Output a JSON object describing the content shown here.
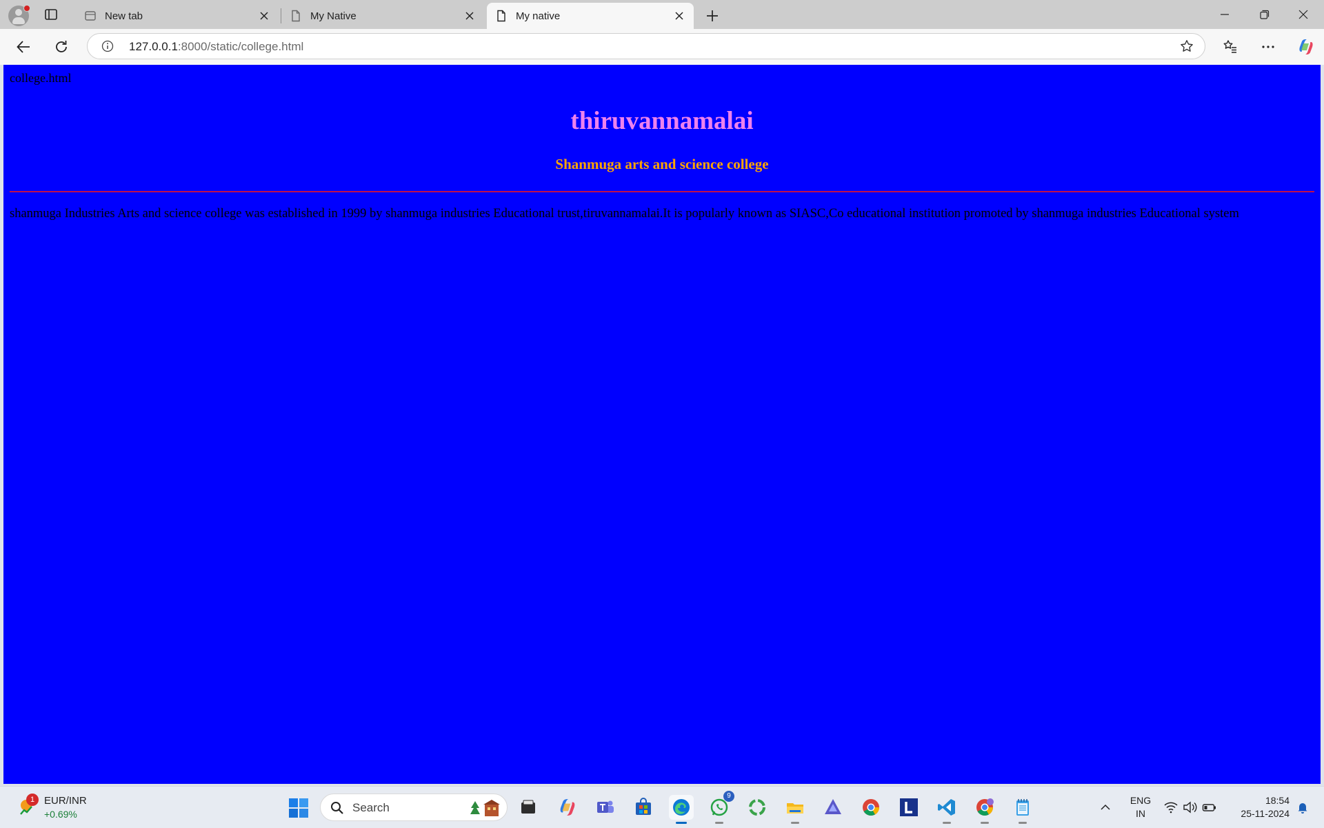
{
  "browser": {
    "tabs": [
      {
        "label": "New tab",
        "active": false
      },
      {
        "label": "My Native",
        "active": false
      },
      {
        "label": "My native",
        "active": true
      }
    ],
    "url_host": "127.0.0.1",
    "url_rest": ":8000/static/college.html"
  },
  "page": {
    "title_text": "college.html",
    "heading": "thiruvannamalai",
    "subheading": "Shanmuga arts and science college",
    "paragraph": "shanmuga Industries Arts and science college was established in 1999 by shanmuga industries Educational trust,tiruvannamalai.It is popularly known as SIASC,Co educational institution promoted by shanmuga industries Educational system",
    "colors": {
      "background": "#0000ff",
      "heading": "#ee82ee",
      "subheading": "#ffa500",
      "rule": "#c0104a"
    }
  },
  "taskbar": {
    "widget": {
      "badge": "1",
      "title": "EUR/INR",
      "value": "+0.69%"
    },
    "search_placeholder": "Search",
    "apps": [
      "files-icon",
      "copilot-icon",
      "teams-icon",
      "store-icon",
      "edge-icon",
      "whatsapp-icon",
      "circle-app-icon",
      "file-explorer-icon",
      "affinity-icon",
      "chrome-icon",
      "l-app-icon",
      "vscode-icon",
      "chrome-profile-icon",
      "notepad-icon"
    ],
    "whatsapp_badge": "9",
    "lang_line1": "ENG",
    "lang_line2": "IN",
    "time": "18:54",
    "date": "25-11-2024"
  }
}
